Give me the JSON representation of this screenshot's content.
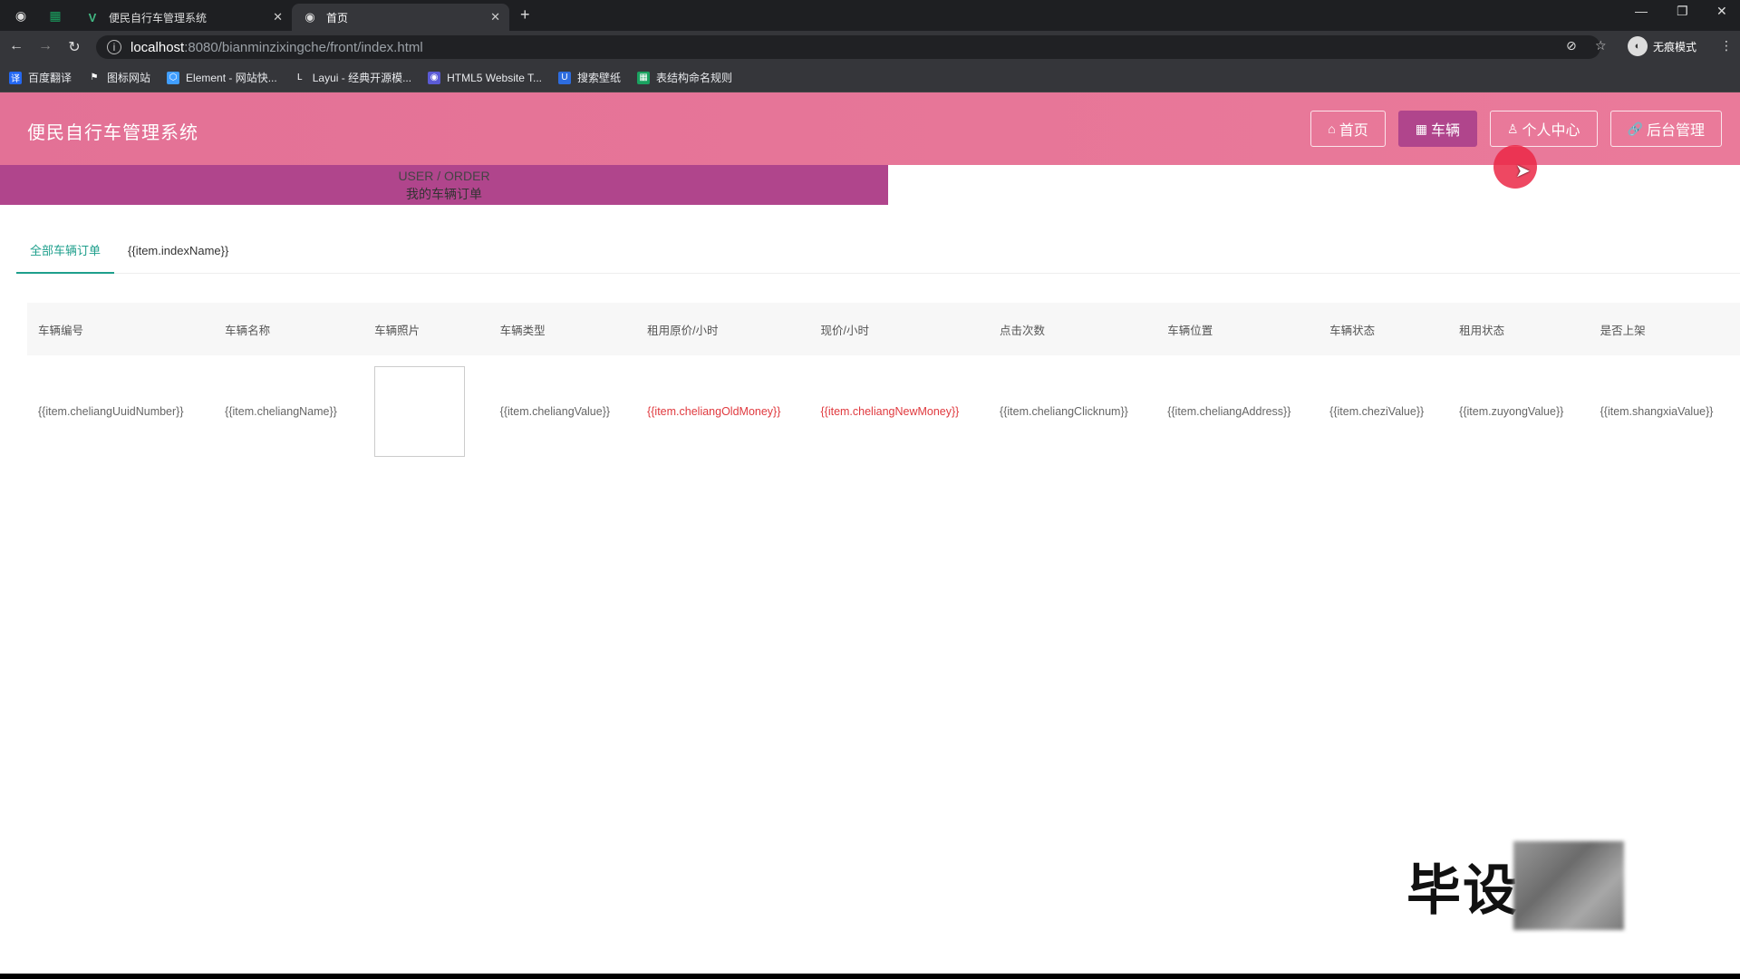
{
  "browser": {
    "tabs": [
      {
        "title": "便民自行车管理系统",
        "favicon": "vue-icon",
        "active": false
      },
      {
        "title": "首页",
        "favicon": "globe-icon",
        "active": true
      }
    ],
    "url_host": "localhost",
    "url_path": ":8080/bianminzixingche/front/index.html",
    "profile_label": "无痕模式",
    "bookmarks": [
      {
        "label": "百度翻译",
        "color": "#2468f2",
        "glyph": "译"
      },
      {
        "label": "图标网站",
        "color": "#35363a",
        "glyph": "⚑"
      },
      {
        "label": "Element - 网站快...",
        "color": "#409eff",
        "glyph": "⬡"
      },
      {
        "label": "Layui - 经典开源模...",
        "color": "#35363a",
        "glyph": "L"
      },
      {
        "label": "HTML5 Website T...",
        "color": "#5b5bd6",
        "glyph": "◉"
      },
      {
        "label": "搜索壁纸",
        "color": "#2d6cdf",
        "glyph": "U"
      },
      {
        "label": "表结构命名规则",
        "color": "#1aa260",
        "glyph": "▦"
      }
    ]
  },
  "header": {
    "site_title": "便民自行车管理系统",
    "nav": [
      {
        "label": "首页",
        "icon": "home-icon",
        "glyph": "⌂",
        "active": false
      },
      {
        "label": "车辆",
        "icon": "grid-icon",
        "glyph": "▦",
        "active": true
      },
      {
        "label": "个人中心",
        "icon": "user-icon",
        "glyph": "♙",
        "active": false
      },
      {
        "label": "后台管理",
        "icon": "link-icon",
        "glyph": "🔗",
        "active": false
      }
    ]
  },
  "banner": {
    "en": "USER / ORDER",
    "zh": "我的车辆订单"
  },
  "tabs": [
    {
      "label": "全部车辆订单",
      "active": true
    },
    {
      "label": "{{item.indexName}}",
      "active": false
    }
  ],
  "table": {
    "headers": [
      "车辆编号",
      "车辆名称",
      "车辆照片",
      "车辆类型",
      "租用原价/小时",
      "现价/小时",
      "点击次数",
      "车辆位置",
      "车辆状态",
      "租用状态",
      "是否上架"
    ],
    "row": {
      "uuid": "{{item.cheliangUuidNumber}}",
      "name": "{{item.cheliangName}}",
      "type": "{{item.cheliangValue}}",
      "old_money": "{{item.cheliangOldMoney}}",
      "new_money": "{{item.cheliangNewMoney}}",
      "clicknum": "{{item.cheliangClicknum}}",
      "address": "{{item.cheliangAddress}}",
      "chezi": "{{item.cheziValue}}",
      "zuyong": "{{item.zuyongValue}}",
      "shangxia": "{{item.shangxiaValue}}"
    }
  },
  "watermark": {
    "text": "毕设"
  }
}
